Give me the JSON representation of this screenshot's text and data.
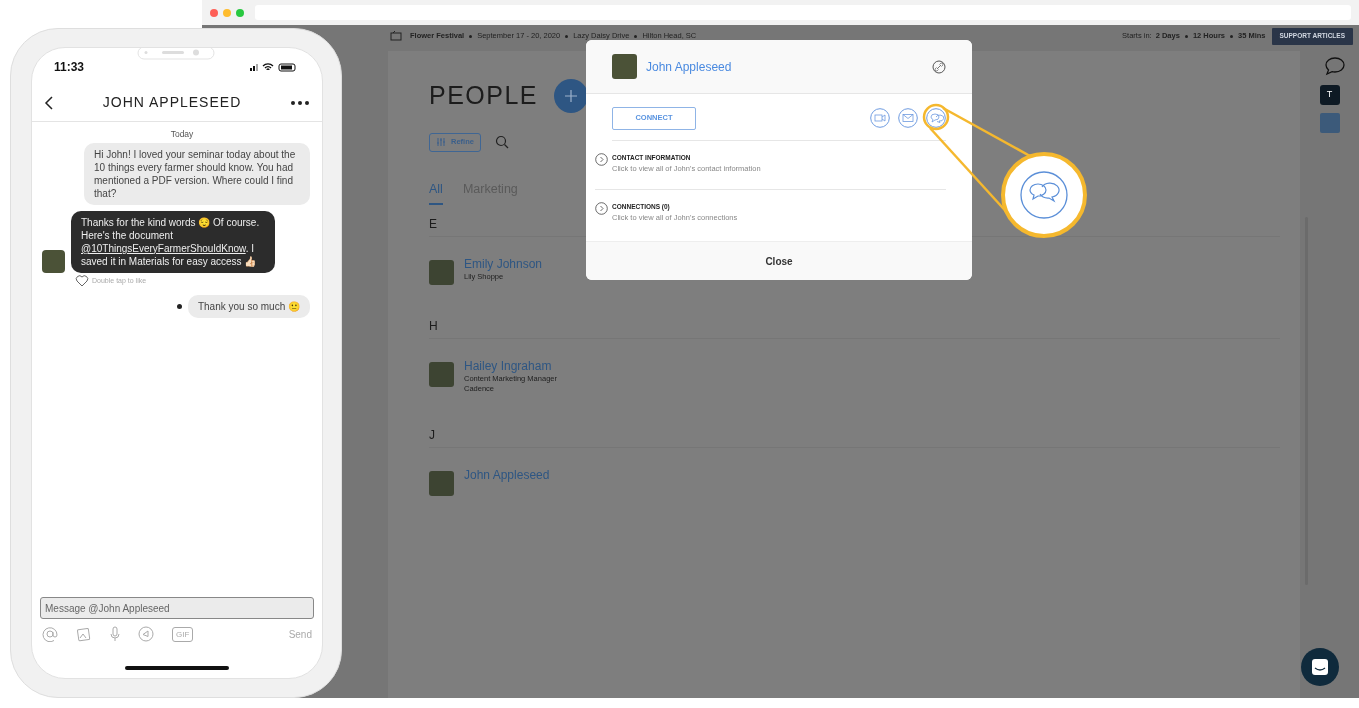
{
  "browser": {
    "header": {
      "event": "Flower Festival",
      "dates": "September 17 - 20, 2020",
      "venue": "Lazy Daisy Drive",
      "city": "Hilton Head, SC",
      "starts_label": "Starts in:",
      "countdown": [
        "2 Days",
        "12 Hours",
        "35 Mins"
      ],
      "support_button": "SUPPORT ARTICLES"
    }
  },
  "people_page": {
    "title": "PEOPLE",
    "refine_button": "Refine",
    "tabs": [
      {
        "label": "All",
        "selected": true
      },
      {
        "label": "Marketing",
        "selected": false
      }
    ],
    "groups": [
      {
        "letter": "E",
        "people": [
          {
            "name": "Emily Johnson",
            "details": [
              "Lily Shoppe"
            ]
          }
        ]
      },
      {
        "letter": "H",
        "people": [
          {
            "name": "Hailey Ingraham",
            "details": [
              "Content Marketing Manager",
              "Cadence"
            ]
          }
        ]
      },
      {
        "letter": "J",
        "people": [
          {
            "name": "John Appleseed"
          }
        ]
      }
    ]
  },
  "sidebar": {
    "badge": "T"
  },
  "modal": {
    "name": "John Appleseed",
    "connect_button": "CONNECT",
    "sections": [
      {
        "title": "CONTACT INFORMATION",
        "subtitle": "Click to view all of John's contact information"
      },
      {
        "title": "CONNECTIONS (0)",
        "subtitle": "Click to view all of John's connections"
      }
    ],
    "close_button": "Close"
  },
  "phone": {
    "time": "11:33",
    "title": "JOHN APPLESEED",
    "day_label": "Today",
    "messages": [
      {
        "kind": "sent",
        "text": "Hi John! I loved your seminar today about the 10 things every farmer should know. You had mentioned a PDF version. Where could I find that?",
        "status_dot": false
      },
      {
        "kind": "received",
        "text": "Thanks for the kind words 😌 Of course. Here's the document ",
        "link": "@10ThingsEveryFarmerShouldKnow",
        "text_after": ". I saved it in Materials for easy access 👍🏻",
        "like_hint": "Double tap to like"
      },
      {
        "kind": "sent",
        "text": "Thank you so much 🙂",
        "status_dot": true
      }
    ],
    "composer": {
      "placeholder": "Message @John Appleseed",
      "gif": "GIF",
      "send": "Send"
    }
  }
}
